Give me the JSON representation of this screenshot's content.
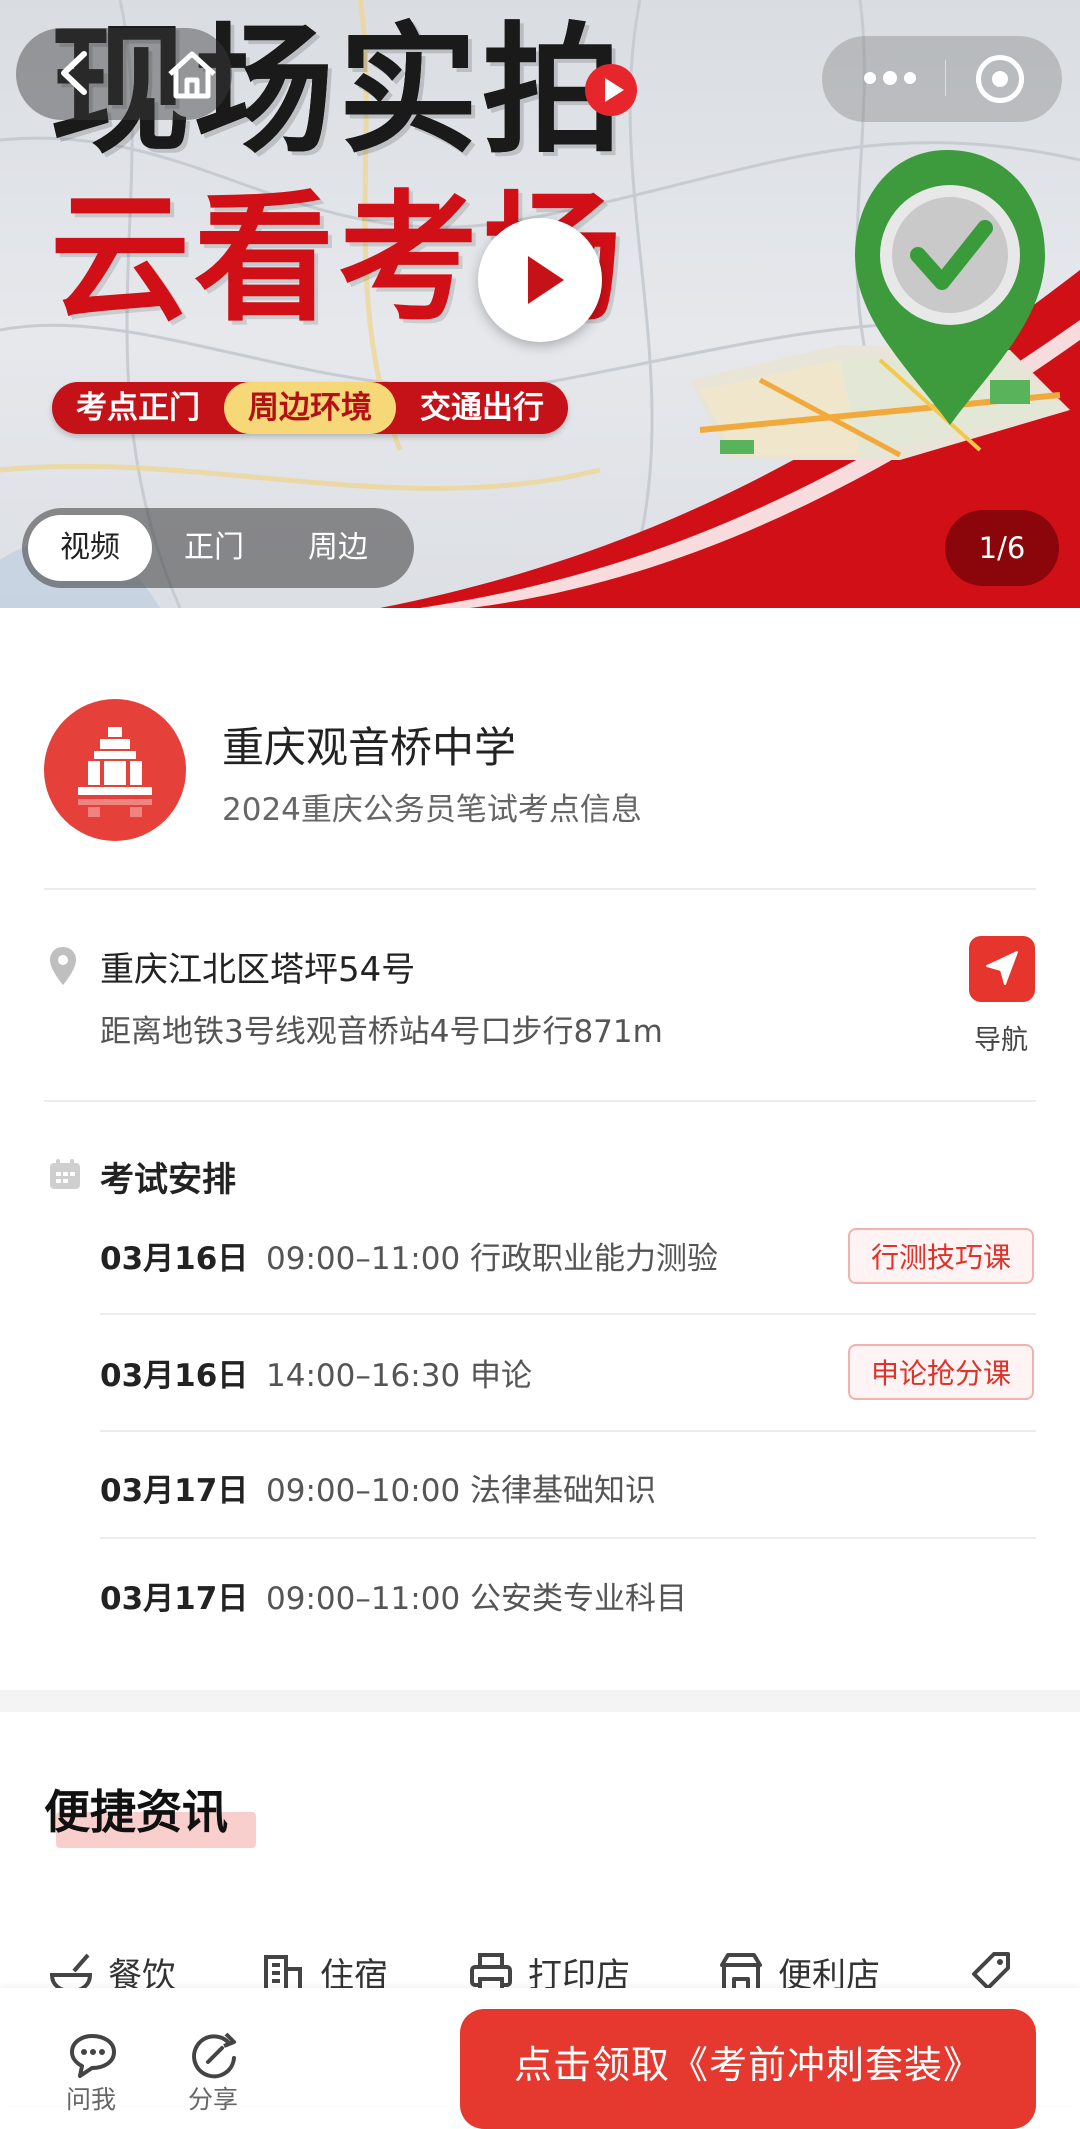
{
  "hero": {
    "title_line1": "现场实拍",
    "title_line2": "云看考场",
    "tags": [
      "考点正门",
      "周边环境",
      "交通出行"
    ],
    "segments": [
      "视频",
      "正门",
      "周边"
    ],
    "active_segment": 0,
    "pager": "1/6"
  },
  "school": {
    "name": "重庆观音桥中学",
    "subtitle": "2024重庆公务员笔试考点信息"
  },
  "location": {
    "address": "重庆江北区塔坪54号",
    "distance": "距离地铁3号线观音桥站4号口步行871m",
    "nav_label": "导航"
  },
  "schedule": {
    "title": "考试安排",
    "rows": [
      {
        "date": "03月16日",
        "time": "09:00–11:00 行政职业能力测验",
        "tag": "行测技巧课"
      },
      {
        "date": "03月16日",
        "time": "14:00–16:30 申论",
        "tag": "申论抢分课"
      },
      {
        "date": "03月17日",
        "time": "09:00–10:00 法律基础知识",
        "tag": ""
      },
      {
        "date": "03月17日",
        "time": "09:00–11:00 公安类专业科目",
        "tag": ""
      }
    ]
  },
  "info": {
    "title": "便捷资讯",
    "categories": [
      {
        "label": "餐饮",
        "icon": "bowl-icon"
      },
      {
        "label": "住宿",
        "icon": "hotel-icon"
      },
      {
        "label": "打印店",
        "icon": "printer-icon"
      },
      {
        "label": "便利店",
        "icon": "store-icon"
      }
    ]
  },
  "bottom_bar": {
    "ask_label": "问我",
    "share_label": "分享",
    "cta_label": "点击领取《考前冲刺套装》"
  },
  "colors": {
    "brand_red": "#e5392f",
    "tag_red": "#e0322a"
  }
}
